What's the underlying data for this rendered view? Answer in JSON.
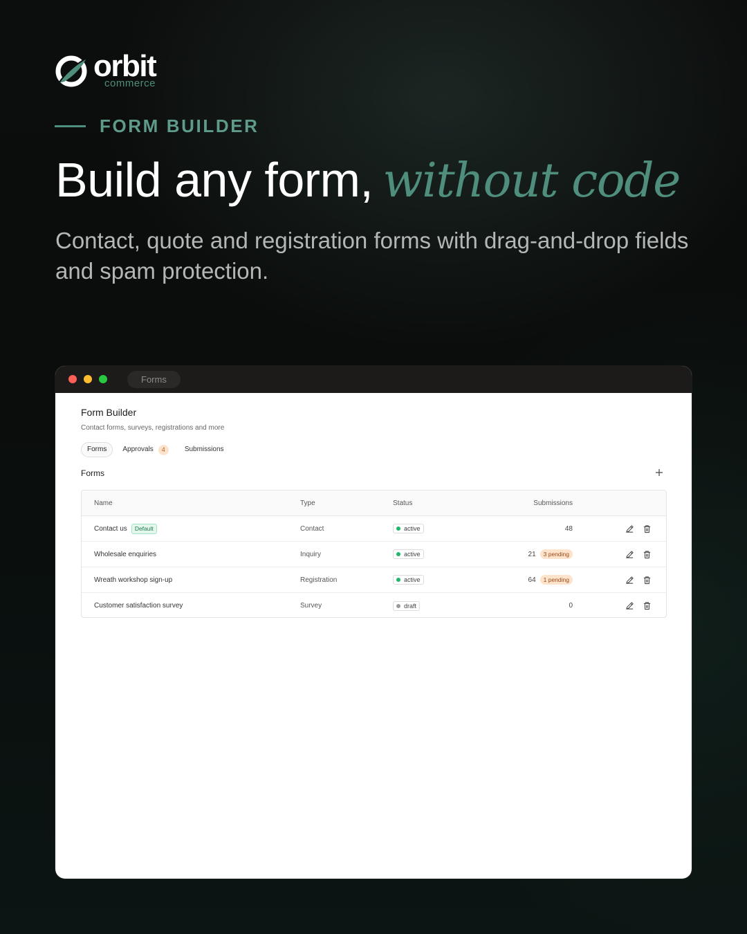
{
  "brand": {
    "name": "orbit",
    "tagline": "commerce",
    "accent_color": "#4f8d7c"
  },
  "hero": {
    "eyebrow": "FORM BUILDER",
    "headline": "Build any form,",
    "headline_accent": "without code",
    "subtitle": "Contact, quote and registration forms with drag-and-drop fields and spam protection."
  },
  "window": {
    "tab_title": "Forms"
  },
  "app": {
    "title": "Form Builder",
    "description": "Contact forms, surveys, registrations and more",
    "tabs": [
      {
        "label": "Forms",
        "active": true
      },
      {
        "label": "Approvals",
        "count": "4"
      },
      {
        "label": "Submissions"
      }
    ],
    "section_title": "Forms",
    "add_icon": "plus-icon",
    "table": {
      "headers": {
        "name": "Name",
        "type": "Type",
        "status": "Status",
        "submissions": "Submissions"
      },
      "rows": [
        {
          "name": "Contact us",
          "badge": "Default",
          "type": "Contact",
          "status": "active",
          "status_color": "#1fb86a",
          "submissions": "48",
          "pending": ""
        },
        {
          "name": "Wholesale enquiries",
          "badge": "",
          "type": "Inquiry",
          "status": "active",
          "status_color": "#1fb86a",
          "submissions": "21",
          "pending": "3 pending"
        },
        {
          "name": "Wreath workshop sign-up",
          "badge": "",
          "type": "Registration",
          "status": "active",
          "status_color": "#1fb86a",
          "submissions": "64",
          "pending": "1 pending"
        },
        {
          "name": "Customer satisfaction survey",
          "badge": "",
          "type": "Survey",
          "status": "draft",
          "status_color": "#9a9a9a",
          "submissions": "0",
          "pending": ""
        }
      ],
      "row_actions": [
        "edit-icon",
        "trash-icon"
      ]
    }
  }
}
